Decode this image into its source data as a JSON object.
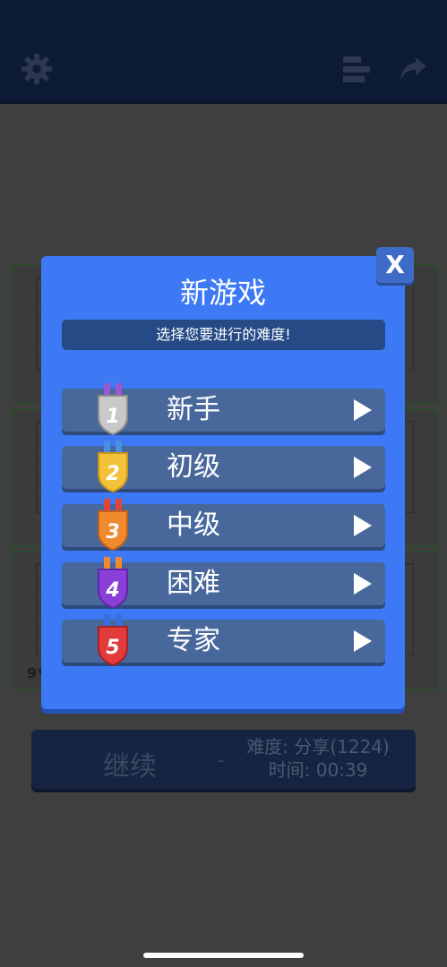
{
  "header": {
    "settings_icon": "gear-icon",
    "stats_icon": "leaderboard-icon",
    "share_icon": "share-icon"
  },
  "background": {
    "card_label": "9*"
  },
  "continue_bar": {
    "label": "继续",
    "dash": "-",
    "difficulty": "难度: 分享(1224)",
    "time": "时间: 00:39"
  },
  "modal": {
    "title": "新游戏",
    "subtitle": "选择您要进行的难度!",
    "close_label": "X",
    "options": [
      {
        "label": "新手",
        "medal_number": "1",
        "medal_color": "#c9c9c9",
        "ribbon_color": "#9b59d0"
      },
      {
        "label": "初级",
        "medal_number": "2",
        "medal_color": "#f2c23a",
        "ribbon_color": "#4a90e2"
      },
      {
        "label": "中级",
        "medal_number": "3",
        "medal_color": "#f08a2e",
        "ribbon_color": "#e0443a"
      },
      {
        "label": "困难",
        "medal_number": "4",
        "medal_color": "#8a3fd8",
        "ribbon_color": "#f08a2e"
      },
      {
        "label": "专家",
        "medal_number": "5",
        "medal_color": "#e23b3b",
        "ribbon_color": "#3a6ee0"
      }
    ]
  },
  "colors": {
    "modal_bg": "#3d79f5",
    "option_bg": "#48689c",
    "topbar_bg": "#0c1a33",
    "overlay_bg": "#3f3f3f"
  }
}
